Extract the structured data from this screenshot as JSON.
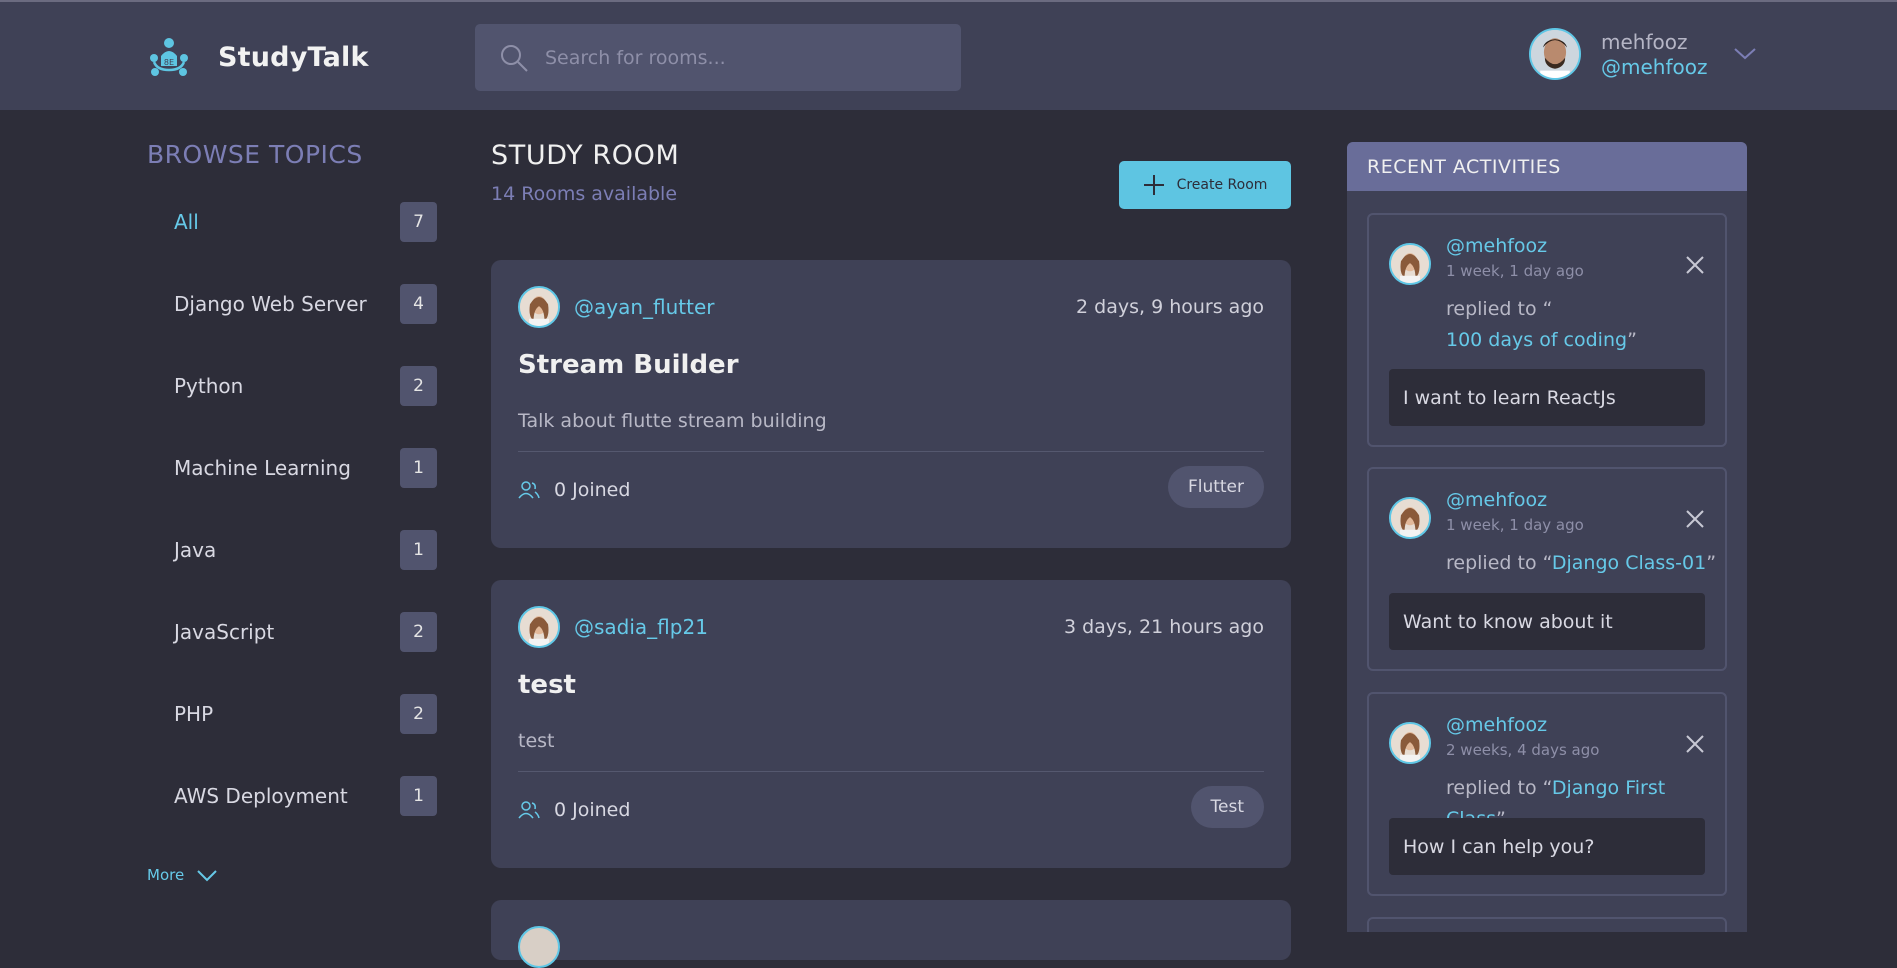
{
  "header": {
    "brand": "StudyTalk",
    "search_placeholder": "Search for rooms...",
    "user_name": "mehfooz",
    "user_handle": "@mehfooz"
  },
  "sidebar": {
    "title": "BROWSE TOPICS",
    "topics": [
      {
        "label": "All",
        "count": "7"
      },
      {
        "label": "Django Web Server",
        "count": "4"
      },
      {
        "label": "Python",
        "count": "2"
      },
      {
        "label": "Machine Learning",
        "count": "1"
      },
      {
        "label": "Java",
        "count": "1"
      },
      {
        "label": "JavaScript",
        "count": "2"
      },
      {
        "label": "PHP",
        "count": "2"
      },
      {
        "label": "AWS Deployment",
        "count": "1"
      }
    ],
    "more_label": "More"
  },
  "main": {
    "title": "STUDY ROOM",
    "rooms_available": "14 Rooms available",
    "create_label": "Create Room",
    "rooms": [
      {
        "host": "@ayan_flutter",
        "time": "2 days, 9 hours ago",
        "title": "Stream Builder",
        "description": "Talk about flutte stream building",
        "joined": "0 Joined",
        "tag": "Flutter"
      },
      {
        "host": "@sadia_flp21",
        "time": "3 days, 21 hours ago",
        "title": "test",
        "description": "test",
        "joined": "0 Joined",
        "tag": "Test"
      }
    ]
  },
  "activities": {
    "title": "RECENT ACTIVITIES",
    "replied_prefix": "replied to “",
    "replied_suffix": "”",
    "items": [
      {
        "user": "@mehfooz",
        "time": "1 week, 1 day ago",
        "room": "100 days of coding",
        "message": "I want to learn ReactJs"
      },
      {
        "user": "@mehfooz",
        "time": "1 week, 1 day ago",
        "room": "Django Class-01",
        "message": "Want to know about it"
      },
      {
        "user": "@mehfooz",
        "time": "2 weeks, 4 days ago",
        "room": "Django First Class",
        "message": "How I can help you?"
      }
    ]
  },
  "colors": {
    "accent": "#66c9e8",
    "background": "#2d2d39",
    "card": "#3f4156",
    "muted_purple": "#7c7eb5"
  }
}
